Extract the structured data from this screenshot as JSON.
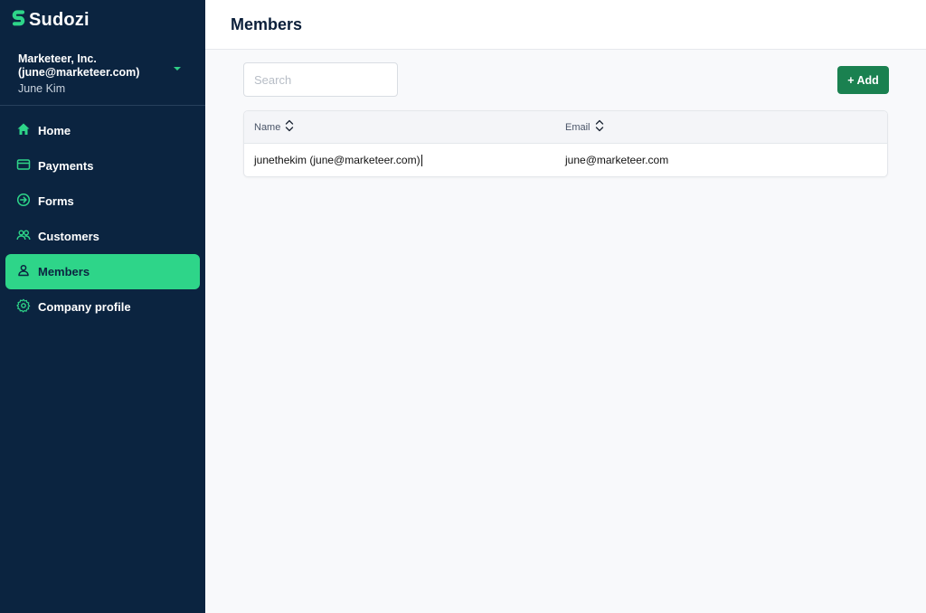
{
  "brand": {
    "name": "Sudozi",
    "accent": "#2ed589"
  },
  "account": {
    "company": "Marketeer, Inc. (june@marketeer.com)",
    "user": "June Kim"
  },
  "nav": [
    {
      "label": "Home",
      "icon": "home-icon"
    },
    {
      "label": "Payments",
      "icon": "credit-card-icon"
    },
    {
      "label": "Forms",
      "icon": "arrow-circle-icon"
    },
    {
      "label": "Customers",
      "icon": "users-icon"
    },
    {
      "label": "Members",
      "icon": "user-icon",
      "active": true
    },
    {
      "label": "Company profile",
      "icon": "gear-icon"
    }
  ],
  "page": {
    "title": "Members"
  },
  "search": {
    "placeholder": "Search",
    "value": ""
  },
  "toolbar": {
    "add_label": "+ Add"
  },
  "table": {
    "columns": [
      "Name",
      "Email"
    ],
    "rows": [
      {
        "name": "junethekim (june@marketeer.com)",
        "email": "june@marketeer.com"
      }
    ]
  },
  "colors": {
    "sidebar_bg": "#0b2440",
    "active_nav": "#2ed589",
    "add_button": "#1a8150"
  }
}
